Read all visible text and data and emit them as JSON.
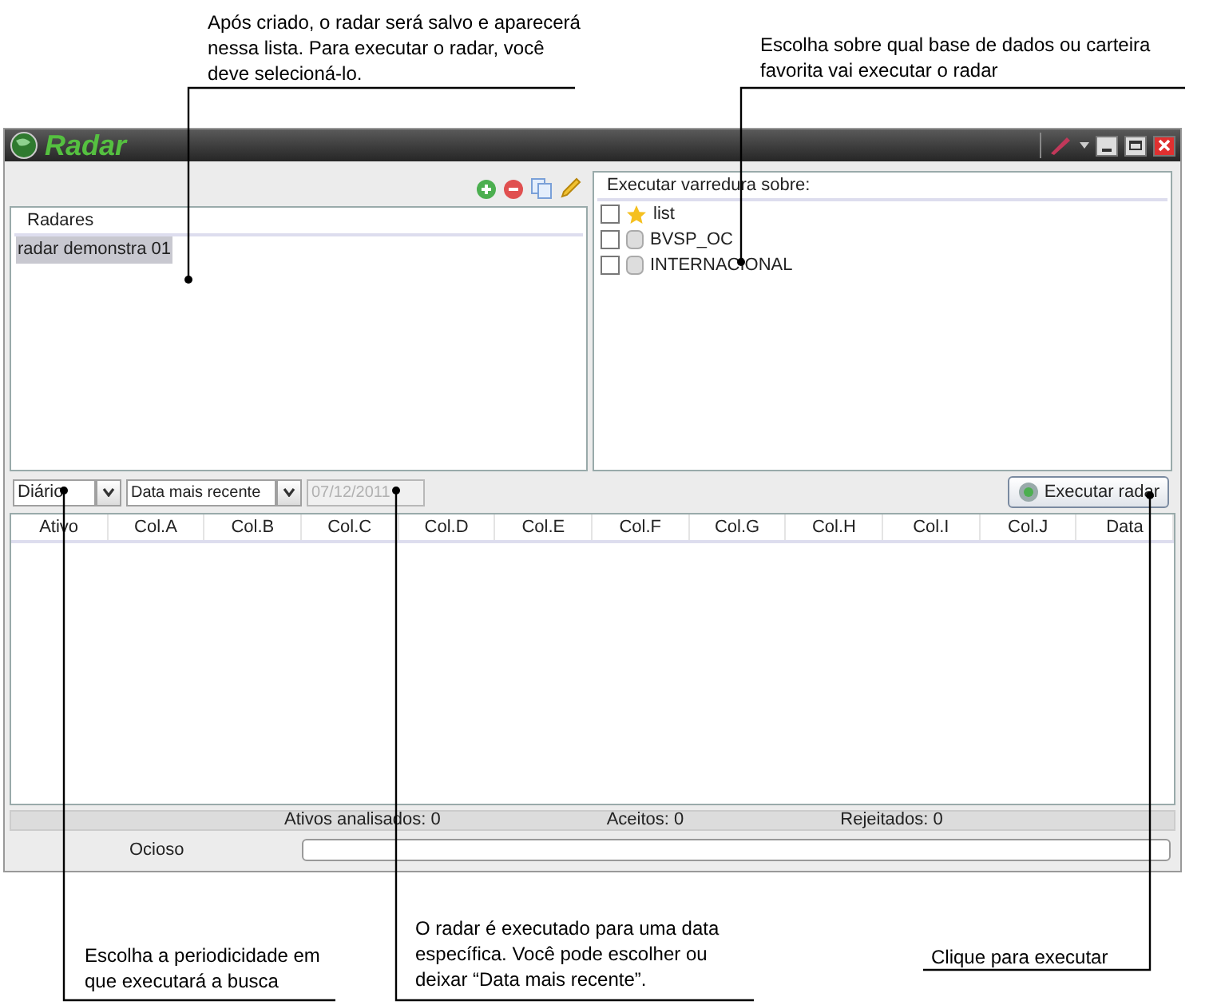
{
  "annotations": [
    {
      "text": "Após criado, o radar será salvo e aparecerá nessa lista. Para executar o radar, você deve selecioná-lo."
    },
    {
      "text": "Escolha sobre qual base de dados ou carteira favorita vai executar o radar"
    },
    {
      "text": "Escolha a periodicidade em que executará a busca"
    },
    {
      "text": "O radar é executado para uma data específica. Você pode escolher ou deixar “Data mais recente”."
    },
    {
      "text": "Clique para executar"
    }
  ],
  "window": {
    "title": "Radar"
  },
  "radar_list": {
    "header": "Radares",
    "items": [
      {
        "label": "radar demonstra 01",
        "selected": true
      }
    ]
  },
  "scan_targets": {
    "header": "Executar varredura sobre:",
    "items": [
      {
        "label": "list",
        "kind": "favorite",
        "checked": false
      },
      {
        "label": "BVSP_OC",
        "kind": "database",
        "checked": false
      },
      {
        "label": "INTERNACIONAL",
        "kind": "database",
        "checked": false
      }
    ]
  },
  "controls": {
    "period": {
      "value": "Diário"
    },
    "date_mode": {
      "value": "Data mais recente"
    },
    "date": {
      "value": "07/12/2011",
      "disabled": true
    },
    "run_button": {
      "label": "Executar radar"
    }
  },
  "table": {
    "columns": [
      "Ativo",
      "Col.A",
      "Col.B",
      "Col.C",
      "Col.D",
      "Col.E",
      "Col.F",
      "Col.G",
      "Col.H",
      "Col.I",
      "Col.J",
      "Data"
    ]
  },
  "status": {
    "analyzed": "Ativos analisados: 0",
    "accepted": "Aceitos: 0",
    "rejected": "Rejeitados: 0",
    "state": "Ocioso",
    "progress": {
      "level": 0
    }
  }
}
